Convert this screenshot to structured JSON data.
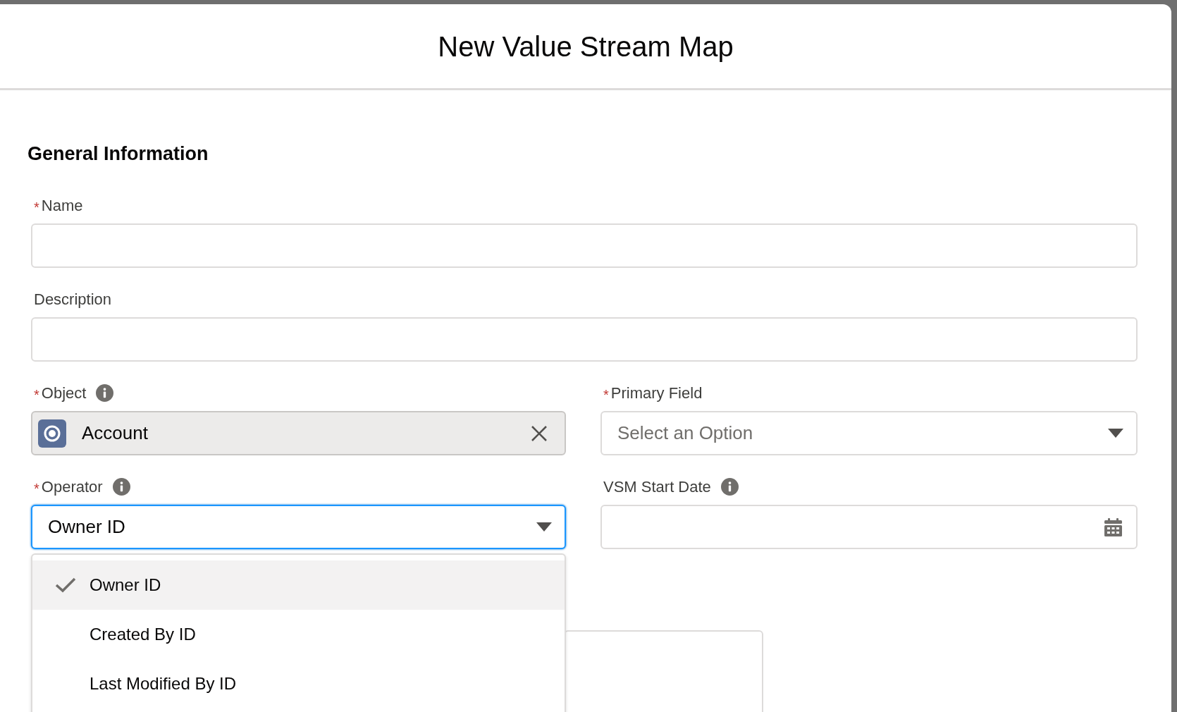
{
  "modal": {
    "title": "New Value Stream Map"
  },
  "section": {
    "title": "General Information"
  },
  "fields": [
    {
      "kind": "text",
      "label": "Name",
      "required_mark": "*",
      "info": false
    },
    {
      "kind": "text",
      "label": "Description",
      "info": false
    },
    {
      "kind": "lookup",
      "label": "Object",
      "required_mark": "*",
      "info": true,
      "value": "Account"
    },
    {
      "kind": "select",
      "label": "Primary Field",
      "required_mark": "*",
      "info": false,
      "placeholder": "Select an Option",
      "focused": false
    },
    {
      "kind": "select",
      "label": "Operator",
      "required_mark": "*",
      "info": true,
      "value": "Owner ID",
      "focused": true,
      "expanded": true
    },
    {
      "kind": "date",
      "label": "VSM Start Date",
      "info": true
    }
  ],
  "dropdown": {
    "options": [
      {
        "label": "Owner ID",
        "selected": true
      },
      {
        "label": "Created By ID",
        "selected": false
      },
      {
        "label": "Last Modified By ID",
        "selected": false
      }
    ]
  }
}
